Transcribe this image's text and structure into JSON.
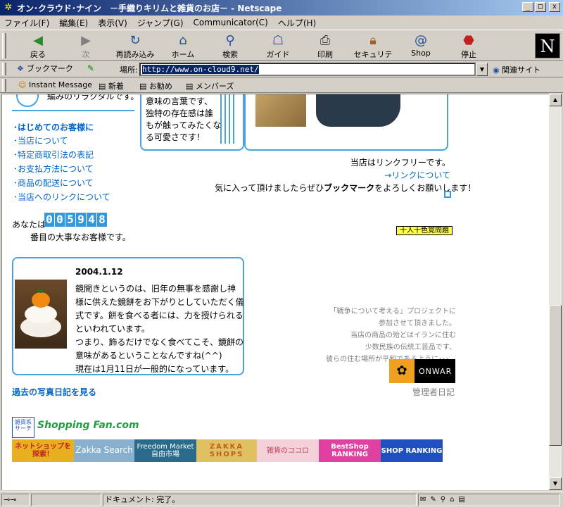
{
  "window": {
    "title": "オン･クラウド･ナイン　－手織りキリムと雑貨のお店－ - Netscape",
    "minimize": "_",
    "maximize": "□",
    "close": "x"
  },
  "menu": [
    "ファイル(F)",
    "編集(E)",
    "表示(V)",
    "ジャンプ(G)",
    "Communicator(C)",
    "ヘルプ(H)"
  ],
  "toolbar": {
    "back": "戻る",
    "forward": "次",
    "reload": "再読み込み",
    "home": "ホーム",
    "search": "検索",
    "guide": "ガイド",
    "print": "印刷",
    "security": "セキュリティ",
    "shop": "Shop",
    "stop": "停止",
    "logo": "N"
  },
  "location": {
    "bookmark_label": "ブックマーク",
    "label": "場所:",
    "url": "http://www.on-cloud9.net/",
    "related": "関連サイト"
  },
  "personal_toolbar": [
    "Instant Message",
    "新着",
    "お勧め",
    "メンバーズ"
  ],
  "content": {
    "top_left_text": "編みのリラクタルです。",
    "mid_text": [
      "意味の言葉です、",
      "独特の存在感は誰",
      "もが触ってみたくな",
      "る可愛さです！"
    ],
    "first_time": "･はじめてのお客様に",
    "nav_links": [
      "･当店について",
      "･特定商取引法の表記",
      "･お支払方法について",
      "･商品の配送について",
      "･当店へのリンクについて"
    ],
    "link_free": "当店はリンクフリーです。",
    "about_link": "→リンクについて",
    "bookmark_pre": "気に入って頂けましたらぜひ",
    "bookmark_bold": "ブックマーク",
    "bookmark_post": "をよろしくお願いします！",
    "visitor_pre": "あなたは",
    "visitor_digits": [
      "0",
      "0",
      "5",
      "9",
      "4",
      "8"
    ],
    "visitor_post": "番目の大事なお客様です。",
    "badge": "十人十色覚問題",
    "diary_date": "2004.1.12",
    "diary_lines": [
      "鏡開きというのは、旧年の無事を感謝し神",
      "様に供えた鏡餅をお下がりとしていただく儀",
      "式です。餅を食べる者には、力を授けられる",
      "といわれています。",
      "つまり、飾るだけでなく食べてこそ、鏡餅の",
      "意味があるということなんですね(^^)",
      "現在は1月11日が一般的になっています。"
    ],
    "past_photos": "過去の写真日記を見る",
    "onwar_lines": [
      "「戦争について考える」プロジェクトに",
      "参加させて頂きました。",
      "当店の商品の殆どはイランに住む",
      "少数民族の伝統工芸品です、",
      "彼らの住む場所が平和であるように･･･。"
    ],
    "onwar_logo": "ONWAR",
    "admin_diary": "管理者日記",
    "search_banner": "雑貨系サーチ",
    "shopping_fan": "Shopping Fan.com",
    "banners": [
      {
        "text": "ネットショップを探索！",
        "bg": "#e8b020"
      },
      {
        "text": "Zakka Search",
        "bg": "#8ab0d0"
      },
      {
        "text": "Freedom Market 自由市場",
        "bg": "#2a6a8a"
      },
      {
        "text": "ZAKKA SHOPS",
        "bg": "#e0c060"
      },
      {
        "text": "雑貨のココロ",
        "bg": "#f4d0d8"
      },
      {
        "text": "BestShop RANKING",
        "bg": "#e040a0"
      },
      {
        "text": "SHOP RANKING",
        "bg": "#2050c0"
      }
    ]
  },
  "status": {
    "text": "ドキュメント: 完了。"
  }
}
